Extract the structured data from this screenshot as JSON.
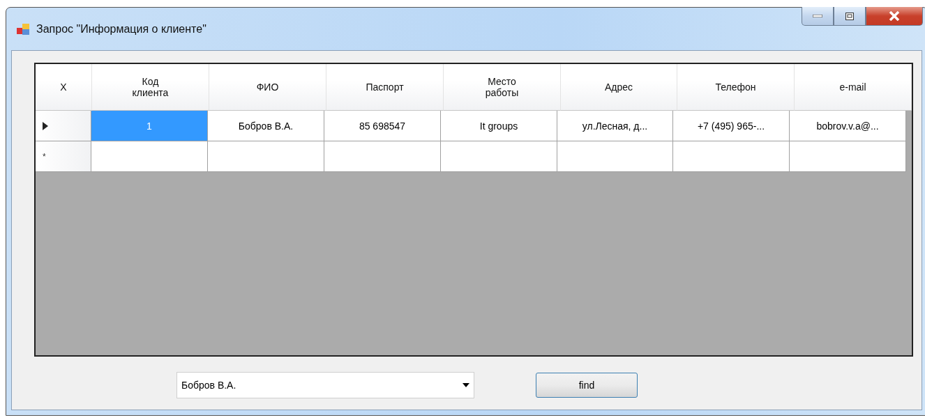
{
  "window": {
    "title": "Запрос \"Информация о клиенте\""
  },
  "grid": {
    "corner": "X",
    "columns": [
      "Код\nклиента",
      "ФИО",
      "Паспорт",
      "Место\nработы",
      "Адрес",
      "Телефон",
      "e-mail"
    ],
    "rows": [
      {
        "kind": "data",
        "current": true,
        "cells": [
          {
            "text": "1",
            "selected": true
          },
          {
            "text": "Бобров В.А.",
            "selected": false
          },
          {
            "text": "85 698547",
            "selected": false
          },
          {
            "text": "It groups",
            "selected": false
          },
          {
            "text": "ул.Лесная, д...",
            "selected": false
          },
          {
            "text": "+7 (495) 965-...",
            "selected": false
          },
          {
            "text": "bobrov.v.a@...",
            "selected": false
          }
        ]
      },
      {
        "kind": "new",
        "current": false,
        "marker": "*"
      }
    ]
  },
  "search": {
    "value": "Бобров В.А."
  },
  "button": {
    "label": "find"
  }
}
